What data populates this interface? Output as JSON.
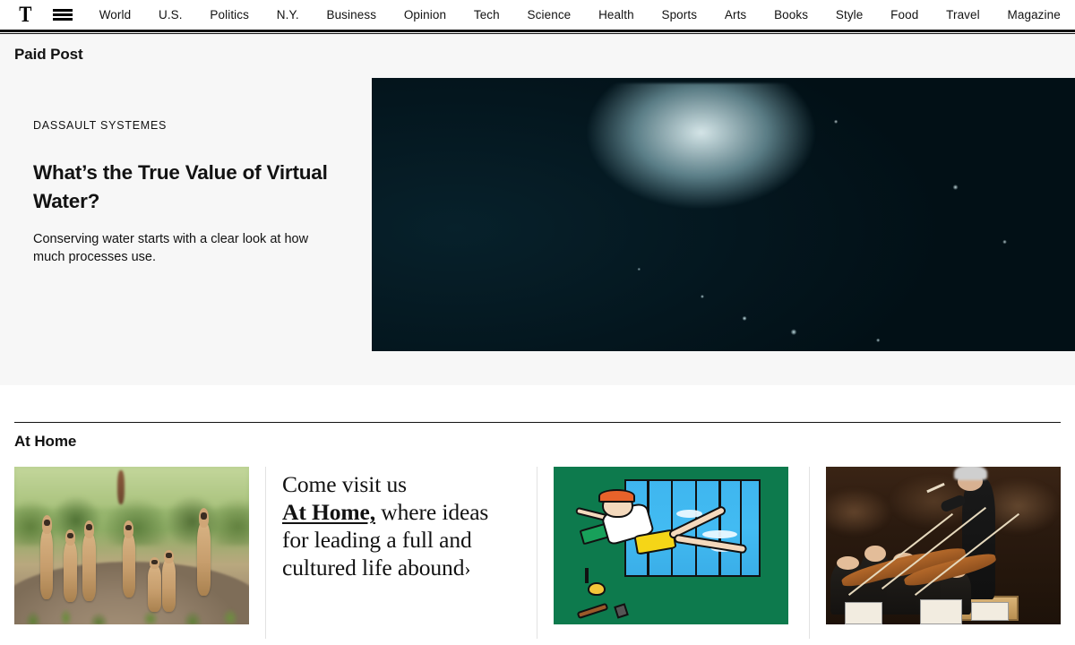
{
  "site": {
    "logo_glyph": "T",
    "logo_name": "nyt-logo"
  },
  "nav": {
    "menu_label": "Menu",
    "items": [
      {
        "label": "World"
      },
      {
        "label": "U.S."
      },
      {
        "label": "Politics"
      },
      {
        "label": "N.Y."
      },
      {
        "label": "Business"
      },
      {
        "label": "Opinion"
      },
      {
        "label": "Tech"
      },
      {
        "label": "Science"
      },
      {
        "label": "Health"
      },
      {
        "label": "Sports"
      },
      {
        "label": "Arts"
      },
      {
        "label": "Books"
      },
      {
        "label": "Style"
      },
      {
        "label": "Food"
      },
      {
        "label": "Travel"
      },
      {
        "label": "Magazine"
      }
    ]
  },
  "paid_post": {
    "section_label": "Paid Post",
    "brand": "DASSAULT SYSTEMES",
    "headline": "What’s the True Value of Virtual Water?",
    "summary": "Conserving water starts with a clear look at how much processes use.",
    "image_alt": "water-splash-image",
    "background_color": "#f7f7f7",
    "image_background_color": "#03161c"
  },
  "at_home": {
    "section_label": "At Home",
    "cards": [
      {
        "type": "image",
        "name": "meerkats-photo",
        "alt": "group-of-meerkats-standing-in-grassland"
      },
      {
        "type": "promo",
        "name": "at-home-promo",
        "line1": "Come visit us",
        "strong": "At Home,",
        "line2_rest": " where ideas",
        "line3": "for leading a full and",
        "line4": "cultured life abound",
        "arrow": "›"
      },
      {
        "type": "image",
        "name": "illustration-person-by-window",
        "alt": "cartoon-person-reclining-by-window-green-background",
        "background_color": "#0d7a4d"
      },
      {
        "type": "image",
        "name": "orchestra-photo",
        "alt": "orchestra-with-conductor-on-stage"
      }
    ]
  }
}
